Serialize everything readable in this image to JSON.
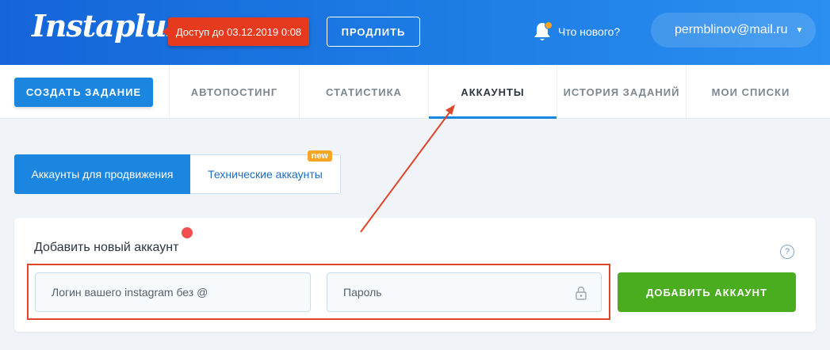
{
  "header": {
    "logo": "Instaplus",
    "access_badge": "Доступ до 03.12.2019 0:08",
    "extend_label": "ПРОДЛИТЬ",
    "whatsnew_label": "Что нового?",
    "user_email": "permblinov@mail.ru",
    "accent_color": "#1b86e0"
  },
  "nav": {
    "create_label": "СОЗДАТЬ ЗАДАНИЕ",
    "tabs": [
      {
        "label": "АВТОПОСТИНГ"
      },
      {
        "label": "СТАТИСТИКА"
      },
      {
        "label": "АККАУНТЫ"
      },
      {
        "label": "ИСТОРИЯ ЗАДАНИЙ"
      },
      {
        "label": "МОИ СПИСКИ"
      }
    ],
    "active_tab": "АККАУНТЫ"
  },
  "subtabs": {
    "promo_label": "Аккаунты для продвижения",
    "tech_label": "Технические аккаунты",
    "new_badge": "new"
  },
  "card": {
    "title": "Добавить новый аккаунт",
    "help": "?",
    "login_placeholder": "Логин вашего instagram без @",
    "password_placeholder": "Пароль",
    "add_label": "ДОБАВИТЬ АККАУНТ"
  }
}
